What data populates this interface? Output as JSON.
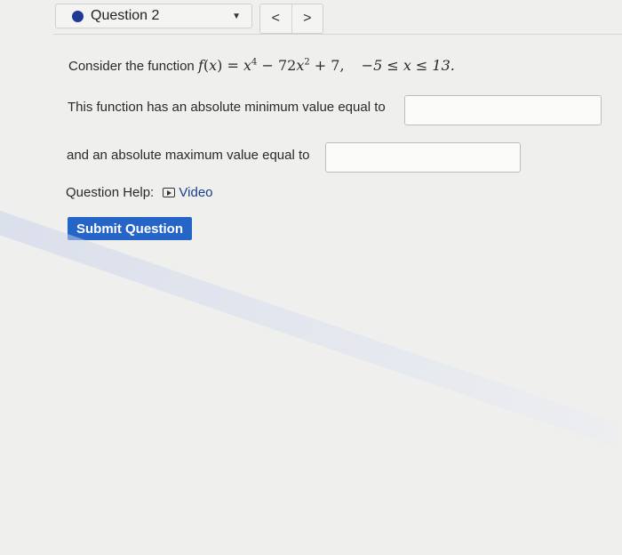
{
  "header": {
    "question_label": "Question 2",
    "prev_glyph": "<",
    "next_glyph": ">",
    "dropdown_glyph": "▼"
  },
  "problem": {
    "intro": "Consider the function",
    "func_name": "f",
    "var": "x",
    "eq_rhs_a": "x",
    "exp4": "4",
    "minus_term": " − 72",
    "term_var": "x",
    "exp2": "2",
    "plus_const": " + 7,",
    "domain_text": "−5 ≤ x ≤ 13.",
    "min_prompt": "This function has an absolute minimum value equal to",
    "max_prompt": "and an absolute maximum value equal to",
    "min_value": "",
    "max_value": ""
  },
  "help": {
    "label": "Question Help:",
    "video_label": "Video"
  },
  "submit_label": "Submit Question",
  "colors": {
    "accent": "#2565c7",
    "dot": "#1f3a93",
    "link": "#1b3c8d",
    "background": "#efefed"
  },
  "icons": {
    "status": "filled-circle-icon",
    "dropdown": "chevron-down-icon",
    "video": "play-icon"
  }
}
